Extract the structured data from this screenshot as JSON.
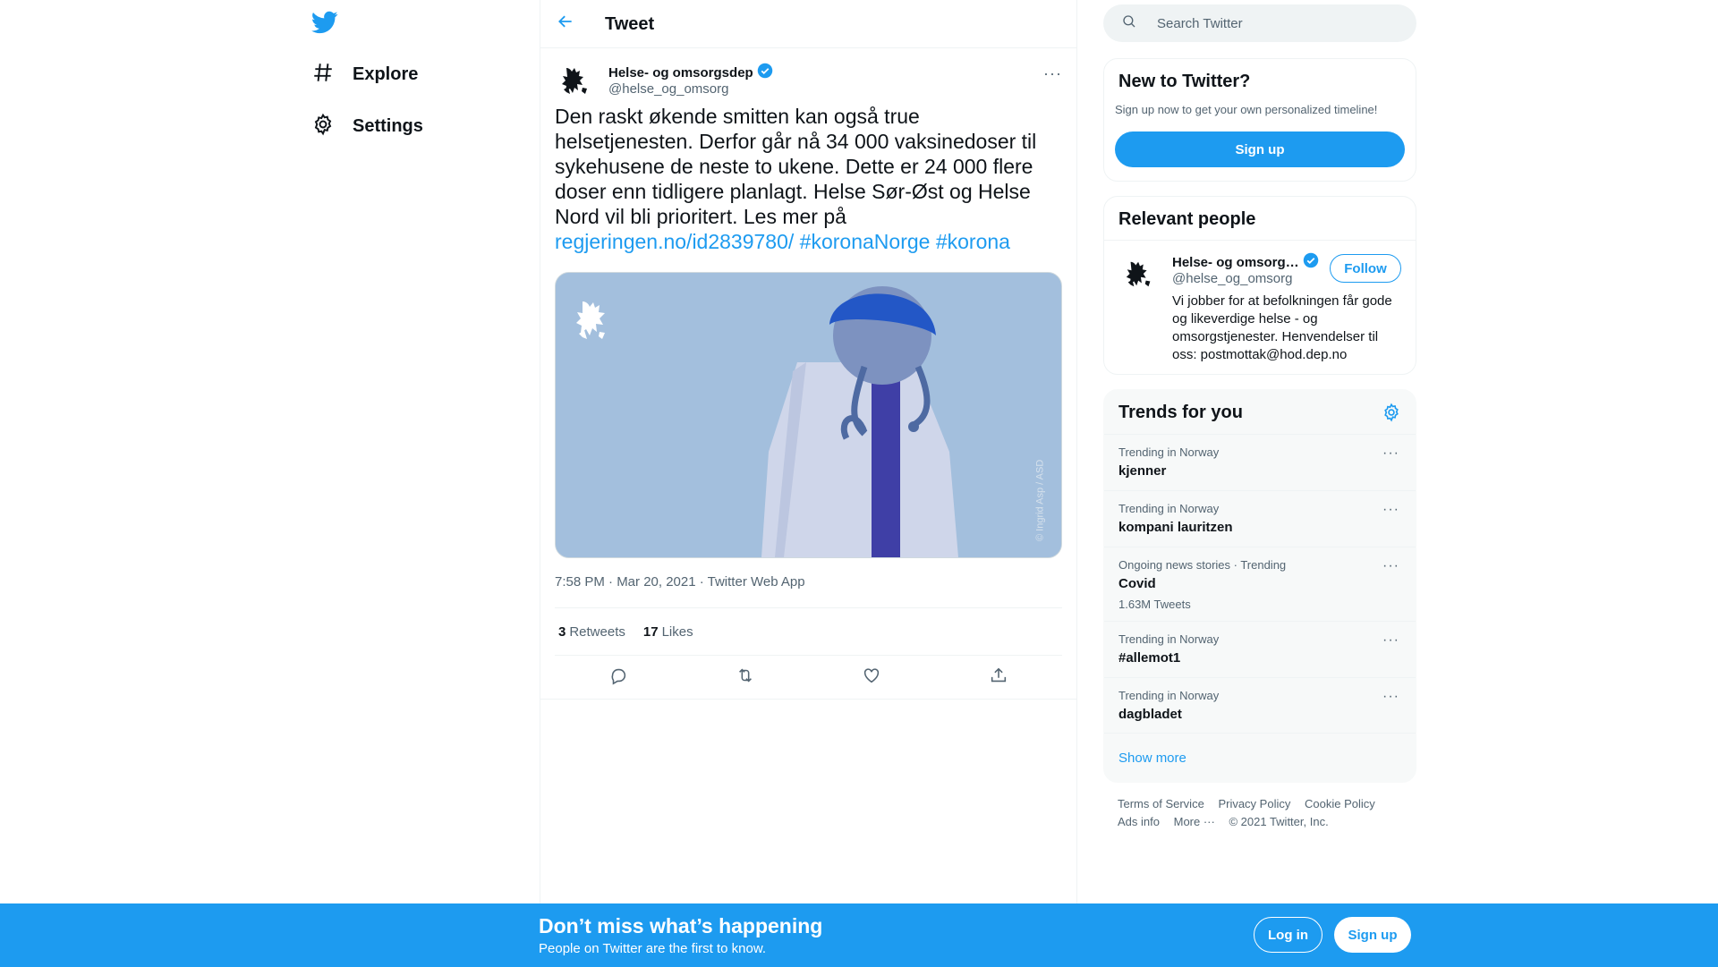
{
  "nav": {
    "logo_icon": "twitter-bird-icon",
    "items": [
      {
        "label": "Explore",
        "icon": "hashtag-icon"
      },
      {
        "label": "Settings",
        "icon": "gear-icon"
      }
    ]
  },
  "header": {
    "title": "Tweet",
    "back_icon": "arrow-left-icon"
  },
  "tweet": {
    "author_name": "Helse- og omsorgsdep",
    "author_handle": "@helse_og_omsorg",
    "verified": true,
    "more_label": "···",
    "text_plain": "Den raskt økende smitten kan også true helsetjenesten. Derfor går nå 34 000 vaksinedoser til sykehusene de neste to ukene. Dette er 24 000 flere doser enn tidligere planlagt. Helse Sør-Øst og Helse Nord vil bli prioritert. Les mer på",
    "link_url": "regjeringen.no/id2839780/",
    "hashtag_1": "#koronaNorge",
    "hashtag_2": "#korona",
    "image_credit": "© Ingrid Asp / ASD",
    "timestamp": "7:58 PM · Mar 20, 2021 · Twitter Web App",
    "retweets_count": "3",
    "retweets_label": "Retweets",
    "likes_count": "17",
    "likes_label": "Likes",
    "actions": [
      "reply-icon",
      "retweet-icon",
      "like-icon",
      "share-icon"
    ]
  },
  "search": {
    "placeholder": "Search Twitter"
  },
  "new_to_twitter": {
    "title": "New to Twitter?",
    "subtitle": "Sign up now to get your own personalized timeline!",
    "button": "Sign up"
  },
  "relevant_people": {
    "title": "Relevant people",
    "name": "Helse- og omsorg…",
    "handle": "@helse_og_omsorg",
    "follow": "Follow",
    "bio": "Vi jobber for at befolkningen får gode og likeverdige helse - og omsorgstjenester. Henvendelser til oss: postmottak@hod.dep.no"
  },
  "trends": {
    "title": "Trends for you",
    "items": [
      {
        "context": "Trending in Norway",
        "name": "kjenner",
        "count": ""
      },
      {
        "context": "Trending in Norway",
        "name": "kompani lauritzen",
        "count": ""
      },
      {
        "context": "Ongoing news stories · Trending",
        "name": "Covid",
        "count": "1.63M Tweets"
      },
      {
        "context": "Trending in Norway",
        "name": "#allemot1",
        "count": ""
      },
      {
        "context": "Trending in Norway",
        "name": "dagbladet",
        "count": ""
      }
    ],
    "show_more": "Show more"
  },
  "footer": {
    "links": [
      "Terms of Service",
      "Privacy Policy",
      "Cookie Policy",
      "Ads info",
      "More ···"
    ],
    "copyright": "© 2021 Twitter, Inc."
  },
  "bottom_bar": {
    "title": "Don’t miss what’s happening",
    "subtitle": "People on Twitter are the first to know.",
    "login": "Log in",
    "signup": "Sign up"
  },
  "colors": {
    "accent": "#1d9bf0",
    "media_bg": "#a3bfdd",
    "text": "#0f1419",
    "muted": "#536471"
  }
}
